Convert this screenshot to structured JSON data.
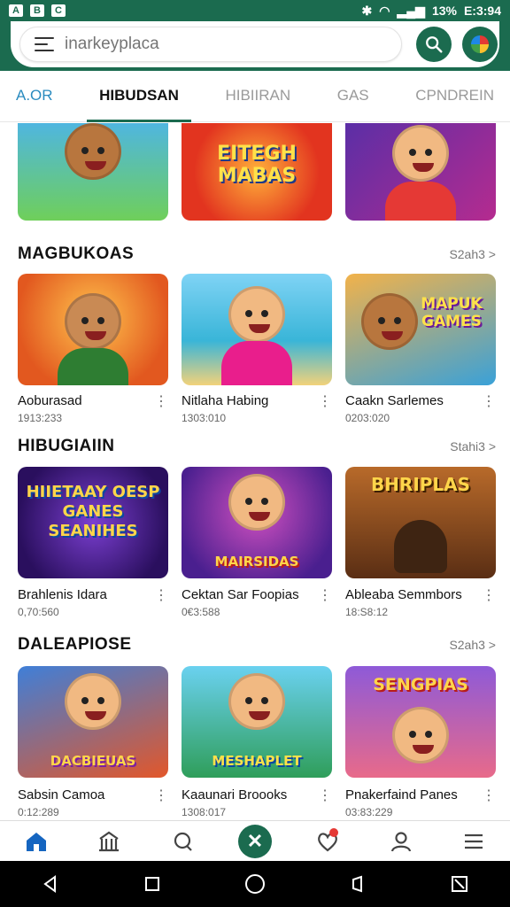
{
  "status_bar": {
    "left_icons": [
      "A",
      "B",
      "C"
    ],
    "battery": "13%",
    "time": "E:3:94"
  },
  "search": {
    "placeholder": "inarkeyplaca"
  },
  "tabs": [
    {
      "label": "A.OR"
    },
    {
      "label": "HIBUDSAN"
    },
    {
      "label": "HIBIIRAN"
    },
    {
      "label": "GAS"
    },
    {
      "label": "CPNDREIN"
    }
  ],
  "top_row": {
    "banner_middle": "EITEGH MABAS"
  },
  "sections": [
    {
      "title": "MAGBUKOAS",
      "more": "S2ah3 >",
      "items": [
        {
          "title": "Aoburasad",
          "sub": "1913:233"
        },
        {
          "title": "Nitlaha Habing",
          "sub": "1303:010"
        },
        {
          "title": "Caakn Sarlemes",
          "sub": "0203:020"
        }
      ],
      "banners": [
        "",
        "",
        "MAPUK GAMES"
      ]
    },
    {
      "title": "HIBUGIAIIN",
      "more": "Stahi3 >",
      "items": [
        {
          "title": "Brahlenis Idara",
          "sub": "0,70:560"
        },
        {
          "title": "Cektan Sar Foopias",
          "sub": "0€3:588"
        },
        {
          "title": "Ableaba Semmbors",
          "sub": "18:S8:12"
        }
      ],
      "banners": [
        "HIIETAAY OESP GANES SEANIHES",
        "MAIRSIDAS",
        "BHRIPLAS"
      ]
    },
    {
      "title": "DALEAPIOSE",
      "more": "S2ah3 >",
      "items": [
        {
          "title": "Sabsin Camoa",
          "sub": "0:12:289"
        },
        {
          "title": "Kaaunari Broooks",
          "sub": "1308:017"
        },
        {
          "title": "Pnakerfaind Panes",
          "sub": "03:83:229"
        }
      ],
      "banners": [
        "DACBIEUAS",
        "MESHAPLET",
        "SENGPIAS"
      ]
    }
  ],
  "colors": {
    "primary": "#1b6b4f",
    "badge": "#e53935"
  },
  "bottom_nav": [
    "home-icon",
    "store-icon",
    "chat-icon",
    "close-icon",
    "heart-icon",
    "profile-icon",
    "menu-icon"
  ],
  "system_nav": [
    "back-icon",
    "overview-icon",
    "home-circle-icon",
    "recent-icon",
    "screenshot-icon"
  ]
}
